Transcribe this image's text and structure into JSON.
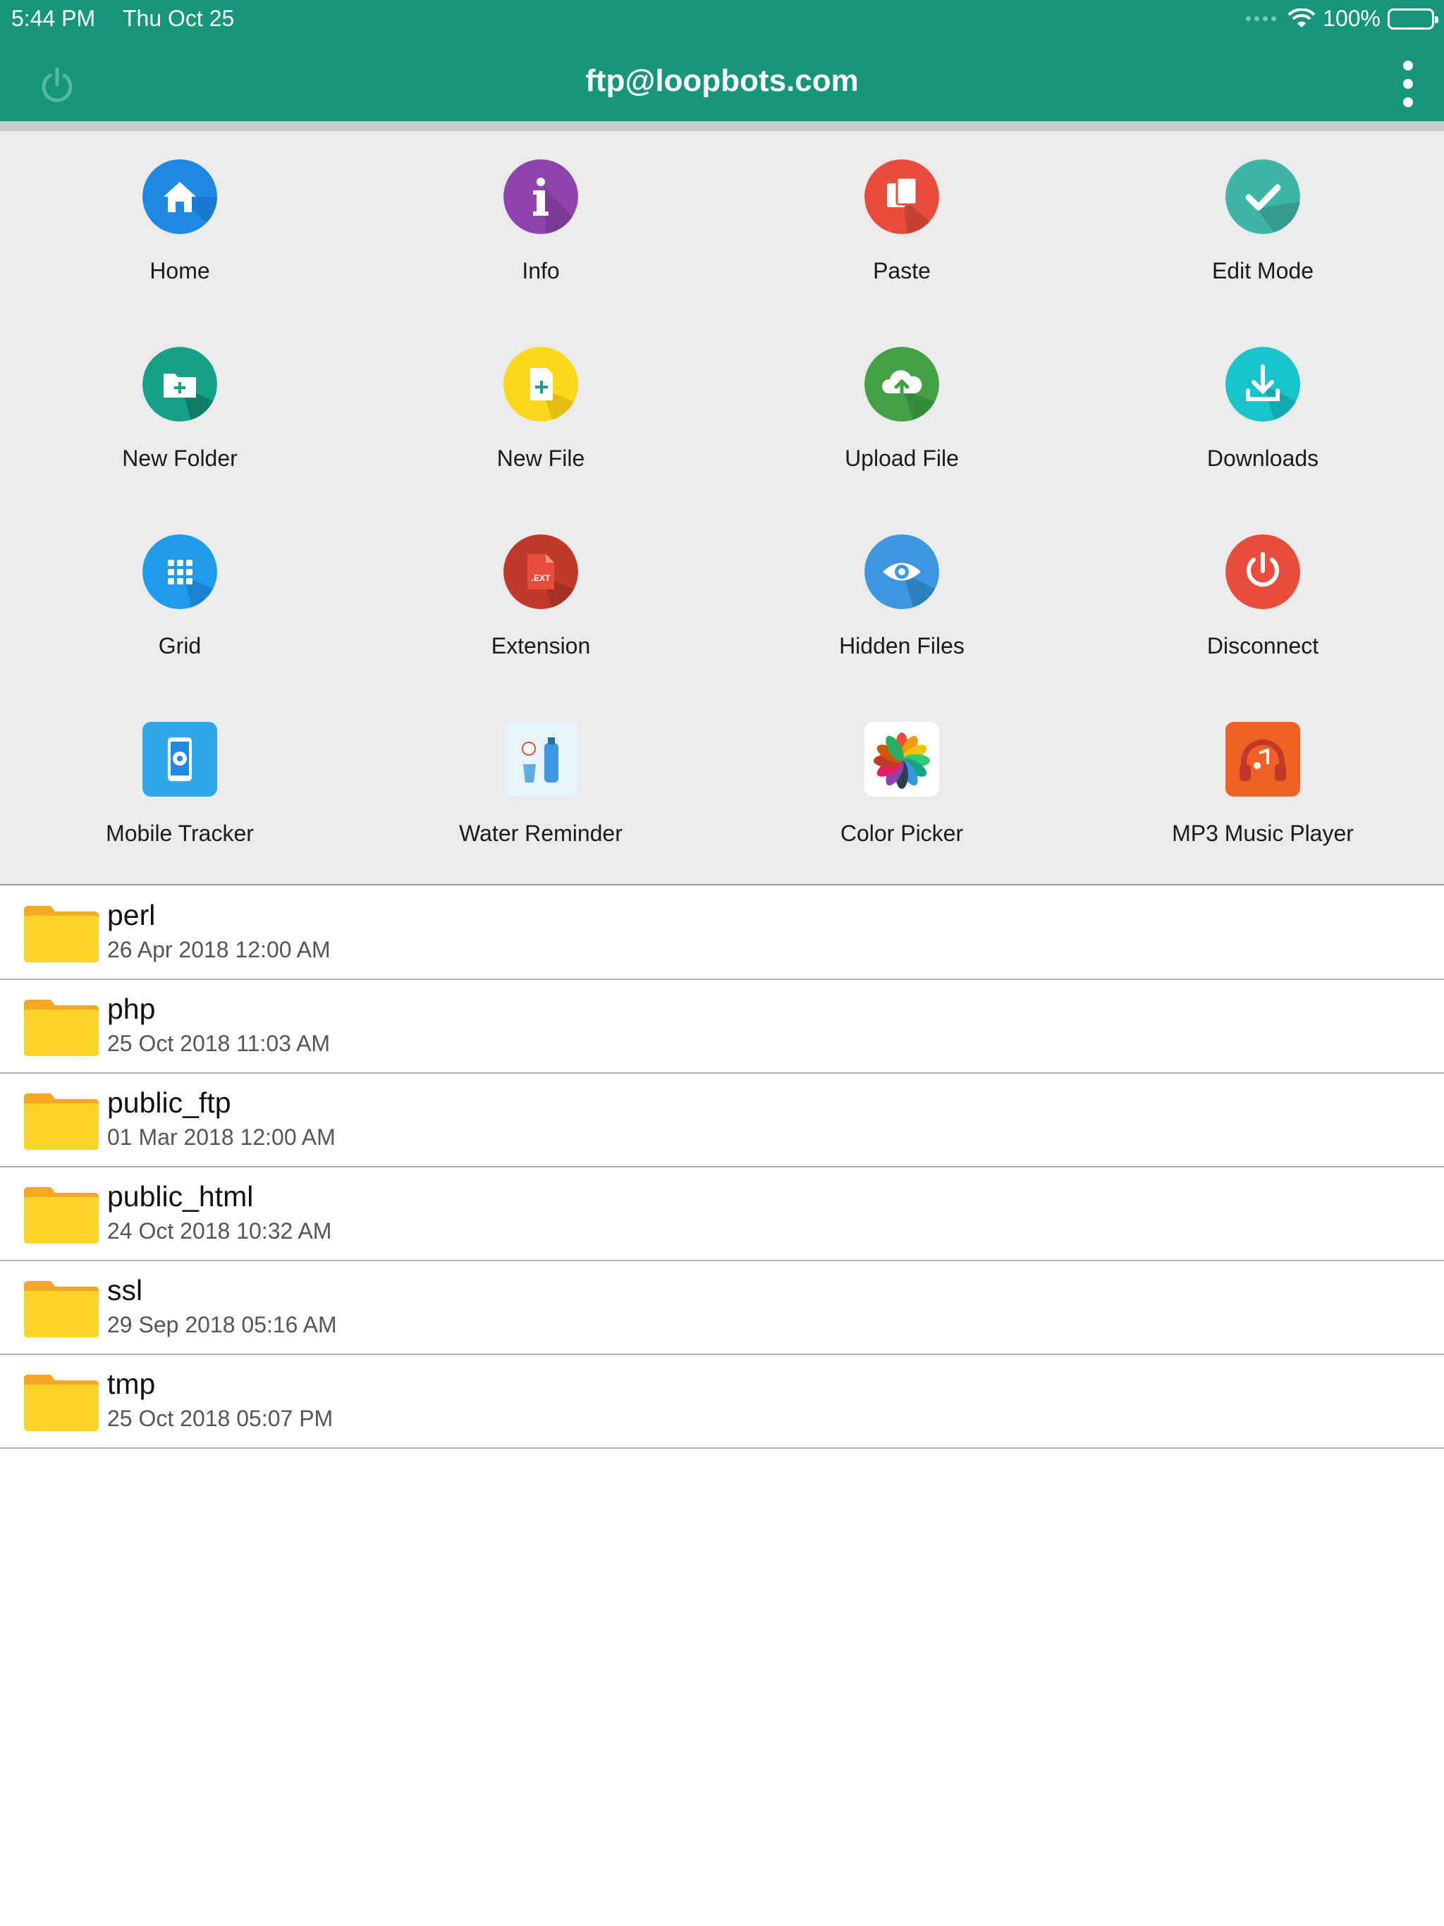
{
  "status_bar": {
    "time": "5:44 PM",
    "date": "Thu Oct 25",
    "battery": "100%"
  },
  "nav": {
    "title": "ftp@loopbots.com"
  },
  "colors": {
    "header": "#16957b",
    "panel": "#ebebeb",
    "folder": "#fbd32b"
  },
  "actions": [
    {
      "label": "Home",
      "icon": "home-icon",
      "color": "#1e88e5"
    },
    {
      "label": "Info",
      "icon": "info-icon",
      "color": "#8e44ad"
    },
    {
      "label": "Paste",
      "icon": "paste-icon",
      "color": "#e74c3c"
    },
    {
      "label": "Edit Mode",
      "icon": "checkmark-icon",
      "color": "#3fb5a5"
    },
    {
      "label": "New Folder",
      "icon": "new-folder-icon",
      "color": "#16a085"
    },
    {
      "label": "New File",
      "icon": "new-file-icon",
      "color": "#f9d71c"
    },
    {
      "label": "Upload File",
      "icon": "cloud-upload-icon",
      "color": "#43a047"
    },
    {
      "label": "Downloads",
      "icon": "download-icon",
      "color": "#18c3c9"
    },
    {
      "label": "Grid",
      "icon": "grid-icon",
      "color": "#1e9be9"
    },
    {
      "label": "Extension",
      "icon": "extension-icon",
      "color": "#c0392b"
    },
    {
      "label": "Hidden Files",
      "icon": "eye-icon",
      "color": "#3c97e0"
    },
    {
      "label": "Disconnect",
      "icon": "power-icon",
      "color": "#e74c3c"
    },
    {
      "label": "Mobile Tracker",
      "icon": "mobile-tracker-app-icon",
      "color": "#2fa7e8"
    },
    {
      "label": "Water Reminder",
      "icon": "water-reminder-app-icon",
      "color": "#e6f3fb"
    },
    {
      "label": "Color Picker",
      "icon": "color-picker-app-icon",
      "color": "#ffffff"
    },
    {
      "label": "MP3 Music Player",
      "icon": "mp3-player-app-icon",
      "color": "#f06123"
    }
  ],
  "files": [
    {
      "name": "perl",
      "date": "26 Apr 2018 12:00 AM"
    },
    {
      "name": "php",
      "date": "25 Oct 2018 11:03 AM"
    },
    {
      "name": "public_ftp",
      "date": "01 Mar 2018 12:00 AM"
    },
    {
      "name": "public_html",
      "date": "24 Oct 2018 10:32 AM"
    },
    {
      "name": "ssl",
      "date": "29 Sep 2018 05:16 AM"
    },
    {
      "name": "tmp",
      "date": "25 Oct 2018 05:07 PM"
    }
  ]
}
